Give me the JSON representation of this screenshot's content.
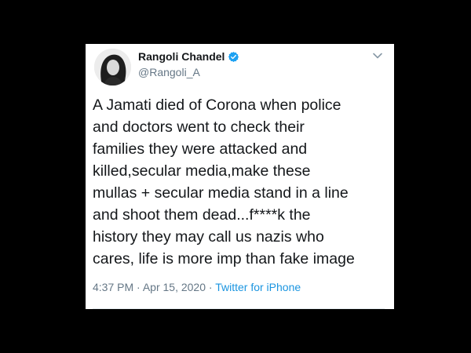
{
  "tweet": {
    "display_name": "Rangoli Chandel",
    "handle": "@Rangoli_A",
    "verified": true,
    "text": "A Jamati died of Corona when police\nand doctors went to check their\nfamilies they were attacked and\nkilled,secular media,make these\nmullas + secular media stand in a line\nand shoot them dead...f****k the\nhistory they may call us nazis who\ncares, life is more imp than fake image",
    "time": "4:37 PM",
    "separator": "·",
    "date": "Apr 15, 2020",
    "source": "Twitter for iPhone"
  },
  "colors": {
    "background": "#000000",
    "card": "#ffffff",
    "text": "#14171a",
    "muted": "#657786",
    "link": "#1b95e0",
    "verified": "#1da1f2"
  },
  "icons": {
    "verified": "verified-badge-icon",
    "menu": "chevron-down-icon"
  }
}
